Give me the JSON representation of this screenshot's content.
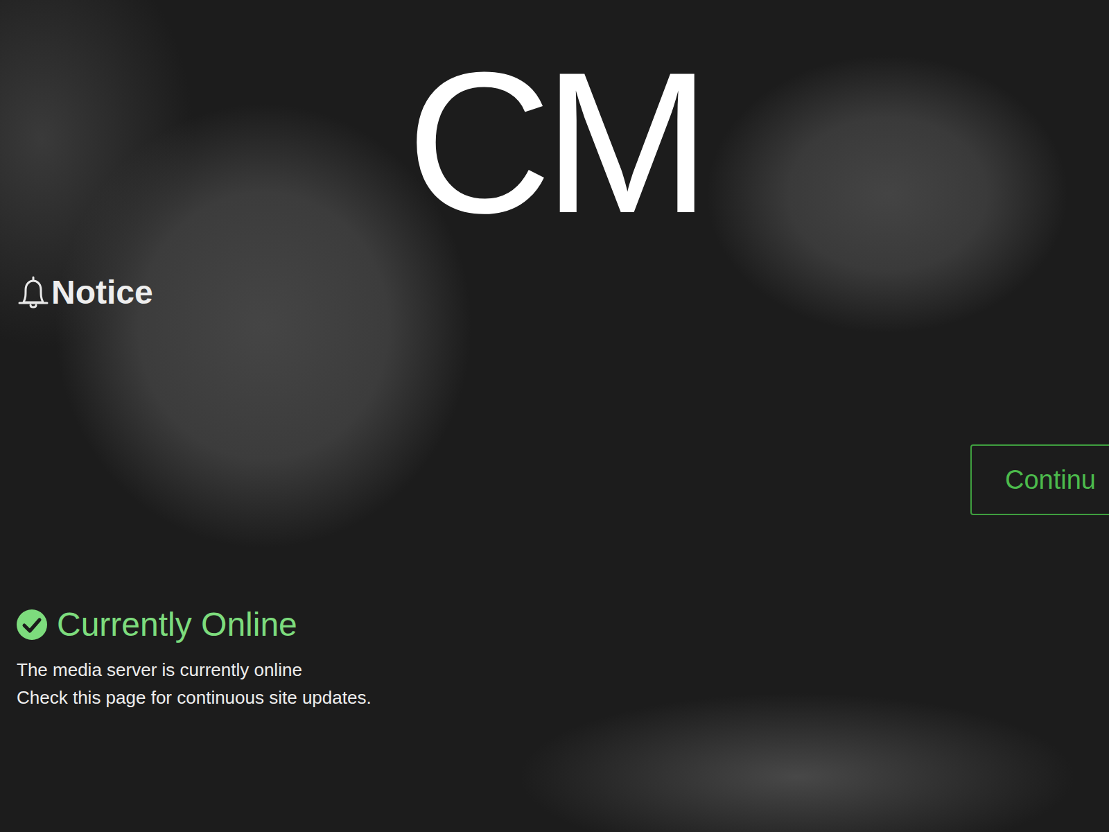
{
  "logo": {
    "text": "CM"
  },
  "notice": {
    "title": "Notice"
  },
  "button": {
    "label": "Continu"
  },
  "status": {
    "title": "Currently Online",
    "online": true,
    "lines": [
      "The media server is currently online",
      "Check this page for continuous site updates."
    ]
  }
}
